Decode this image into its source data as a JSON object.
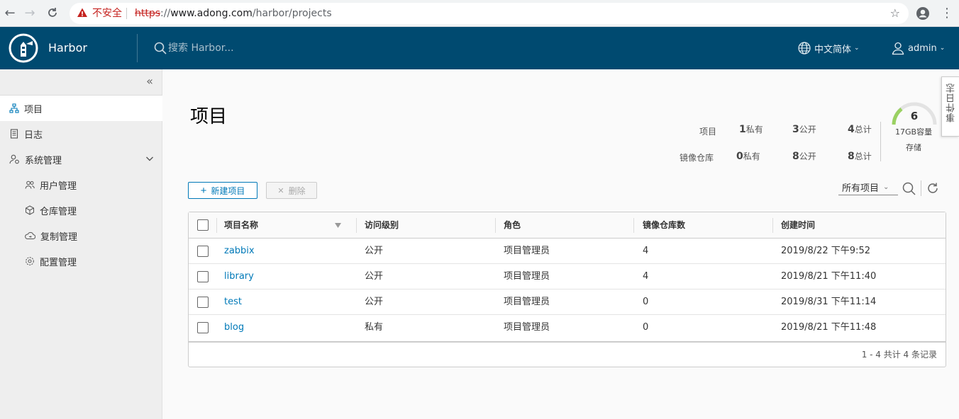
{
  "browser": {
    "insecure_label": "不安全",
    "url_scheme": "https",
    "url_sep": "://",
    "url_host": "www.adong.com",
    "url_path": "/harbor/projects"
  },
  "header": {
    "brand": "Harbor",
    "search_placeholder": "搜索 Harbor...",
    "language": "中文简体",
    "user": "admin",
    "bg_color": "#004a70"
  },
  "sidebar": {
    "items": [
      {
        "label": "项目",
        "icon": "projects-icon"
      },
      {
        "label": "日志",
        "icon": "logs-icon"
      },
      {
        "label": "系统管理",
        "icon": "admin-icon"
      }
    ],
    "sub_items": [
      {
        "label": "用户管理",
        "icon": "users-icon"
      },
      {
        "label": "仓库管理",
        "icon": "registry-icon"
      },
      {
        "label": "复制管理",
        "icon": "replication-icon"
      },
      {
        "label": "配置管理",
        "icon": "settings-icon"
      }
    ]
  },
  "event_log_tab": "事件日志",
  "main": {
    "title": "项目",
    "stats": {
      "projects_label": "项目",
      "repos_label": "镜像仓库",
      "projects": {
        "private_num": "1",
        "private_label": "私有",
        "public_num": "3",
        "public_label": "公开",
        "total_num": "4",
        "total_label": "总计"
      },
      "repos": {
        "private_num": "0",
        "private_label": "私有",
        "public_num": "8",
        "public_label": "公开",
        "total_num": "8",
        "total_label": "总计"
      }
    },
    "storage": {
      "count": "6",
      "capacity": "17GB容量",
      "label": "存储"
    },
    "new_button": "新建项目",
    "delete_button": "删除",
    "filter": "所有项目",
    "accent_color": "#0079b8"
  },
  "table": {
    "headers": [
      "项目名称",
      "访问级别",
      "角色",
      "镜像仓库数",
      "创建时间"
    ],
    "rows": [
      {
        "name": "zabbix",
        "access": "公开",
        "role": "项目管理员",
        "repos": "4",
        "created": "2019/8/22 下午9:52"
      },
      {
        "name": "library",
        "access": "公开",
        "role": "项目管理员",
        "repos": "4",
        "created": "2019/8/21 下午11:40"
      },
      {
        "name": "test",
        "access": "公开",
        "role": "项目管理员",
        "repos": "0",
        "created": "2019/8/31 下午11:14"
      },
      {
        "name": "blog",
        "access": "私有",
        "role": "项目管理员",
        "repos": "0",
        "created": "2019/8/21 下午11:48"
      }
    ],
    "footer": "1 - 4 共计 4 条记录"
  }
}
